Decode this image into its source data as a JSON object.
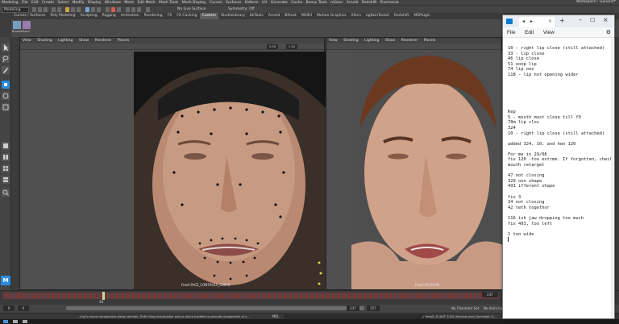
{
  "maya": {
    "menubar": [
      "Modeling",
      "File",
      "Edit",
      "Create",
      "Select",
      "Modify",
      "Display",
      "Windows",
      "Mesh",
      "Edit Mesh",
      "Mesh Tools",
      "Mesh Display",
      "Curves",
      "Surfaces",
      "Deform",
      "UV",
      "Generate",
      "Cache",
      "Bonus Tools",
      "mGear",
      "Arnold",
      "Redshift",
      "Pixomania"
    ],
    "workspace_label": "Workspace : General*",
    "mode_value": "Modeling",
    "live_surface_label": "No Live Surface",
    "symmetry_label": "Symmetry: Off",
    "shelf_tabs": [
      "Curves / Surfaces",
      "Poly Modeling",
      "Sculpting",
      "Rigging",
      "Animation",
      "Rendering",
      "FX",
      "FX Caching",
      "Custom",
      "StudioLibrary",
      "bhTools",
      "Arnold",
      "Bifrost",
      "MASH",
      "Motion Graphics",
      "XGen",
      "ngSkinTools2",
      "Redshift",
      "MSPlugin"
    ],
    "active_shelf_tab": "Custom",
    "shelf_buttons": [
      "Browse",
      "Save"
    ],
    "left_viewport": {
      "menu": [
        "View",
        "Shading",
        "Lighting",
        "Show",
        "Renderer",
        "Panels"
      ],
      "field_values": [
        "0.00",
        "1.00"
      ],
      "camera_label": "Front:FACE_CONTROLS_CAM:Z"
    },
    "right_viewport": {
      "menu": [
        "View",
        "Shading",
        "Lighting",
        "Show",
        "Renderer",
        "Panels"
      ],
      "camera_label": "Front:FACECAM"
    },
    "timeline": {
      "current_frame": "237",
      "start": "0",
      "end": "257",
      "marker": "28"
    },
    "range": {
      "start": "0",
      "inner_start": "0",
      "inner_end": "237",
      "end": "257",
      "character_set": "No Character Set",
      "anim_layer": "No Anim Layer"
    },
    "command_line": {
      "lang": "MEL",
      "result": "// Result: E:/AUT 2024 (Second year) Semester 2/...",
      "help": "...ing to move components along normals. Shift+drag manipulator axis or plane handles to extrude components or s..."
    }
  },
  "notepad": {
    "menu": [
      "File",
      "Edit",
      "View"
    ],
    "lines": [
      "10 - right lip close (still attached)",
      "33 - lip close",
      "46 lip close",
      "51 ooop lip",
      "74 lip ooo",
      "118 - lip not opening wider",
      "",
      "",
      "",
      "",
      "",
      "",
      "Kep",
      "5 - mouth must close till f9",
      "70m lip clos",
      "324",
      "10 - right lip close (still attached)",
      "",
      "added 324, 10, and hen 120",
      "",
      "For me in 29/08",
      "fix 120 -too extrme. If forgotten, check",
      "mouth retarget",
      "",
      "47 not closing",
      "329 ooo shape",
      "493 ifferent shape",
      "",
      "fix 3",
      "34 not closing",
      "42 teth togethor",
      "",
      "116 ish jaw dropping too much",
      "fix 493, too left",
      "",
      "1 too wide"
    ]
  },
  "colors": {
    "maya_dark": "#3c3c3c",
    "timeline_red": "#8b2c2c",
    "notepad_bg": "#ffffff",
    "accent_blue": "#2b8de0"
  }
}
